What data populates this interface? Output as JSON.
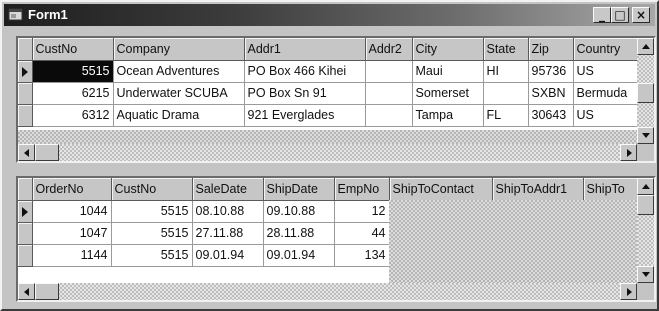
{
  "window": {
    "title": "Form1",
    "buttons": {
      "minimize": "_",
      "maximize": "□",
      "close": "×"
    }
  },
  "customers_grid": {
    "columns": [
      "CustNo",
      "Company",
      "Addr1",
      "Addr2",
      "City",
      "State",
      "Zip",
      "Country"
    ],
    "rows": [
      [
        "5515",
        "Ocean Adventures",
        "PO Box 466 Kihei",
        "",
        "Maui",
        "HI",
        "95736",
        "US"
      ],
      [
        "6215",
        "Underwater SCUBA",
        "PO Box Sn 91",
        "",
        "Somerset",
        "",
        "SXBN",
        "Bermuda"
      ],
      [
        "6312",
        "Aquatic Drama",
        "921 Everglades",
        "",
        "Tampa",
        "FL",
        "30643",
        "US"
      ]
    ],
    "current_row": 0,
    "selected_cell": "CustNo"
  },
  "orders_grid": {
    "columns": [
      "OrderNo",
      "CustNo",
      "SaleDate",
      "ShipDate",
      "EmpNo",
      "ShipToContact",
      "ShipToAddr1",
      "ShipTo"
    ],
    "rows": [
      [
        "1044",
        "5515",
        "08.10.88",
        "09.10.88",
        "12",
        "",
        "",
        ""
      ],
      [
        "1047",
        "5515",
        "27.11.88",
        "28.11.88",
        "44",
        "",
        "",
        ""
      ],
      [
        "1144",
        "5515",
        "09.01.94",
        "09.01.94",
        "134",
        "",
        "",
        ""
      ]
    ],
    "current_row": 0
  }
}
